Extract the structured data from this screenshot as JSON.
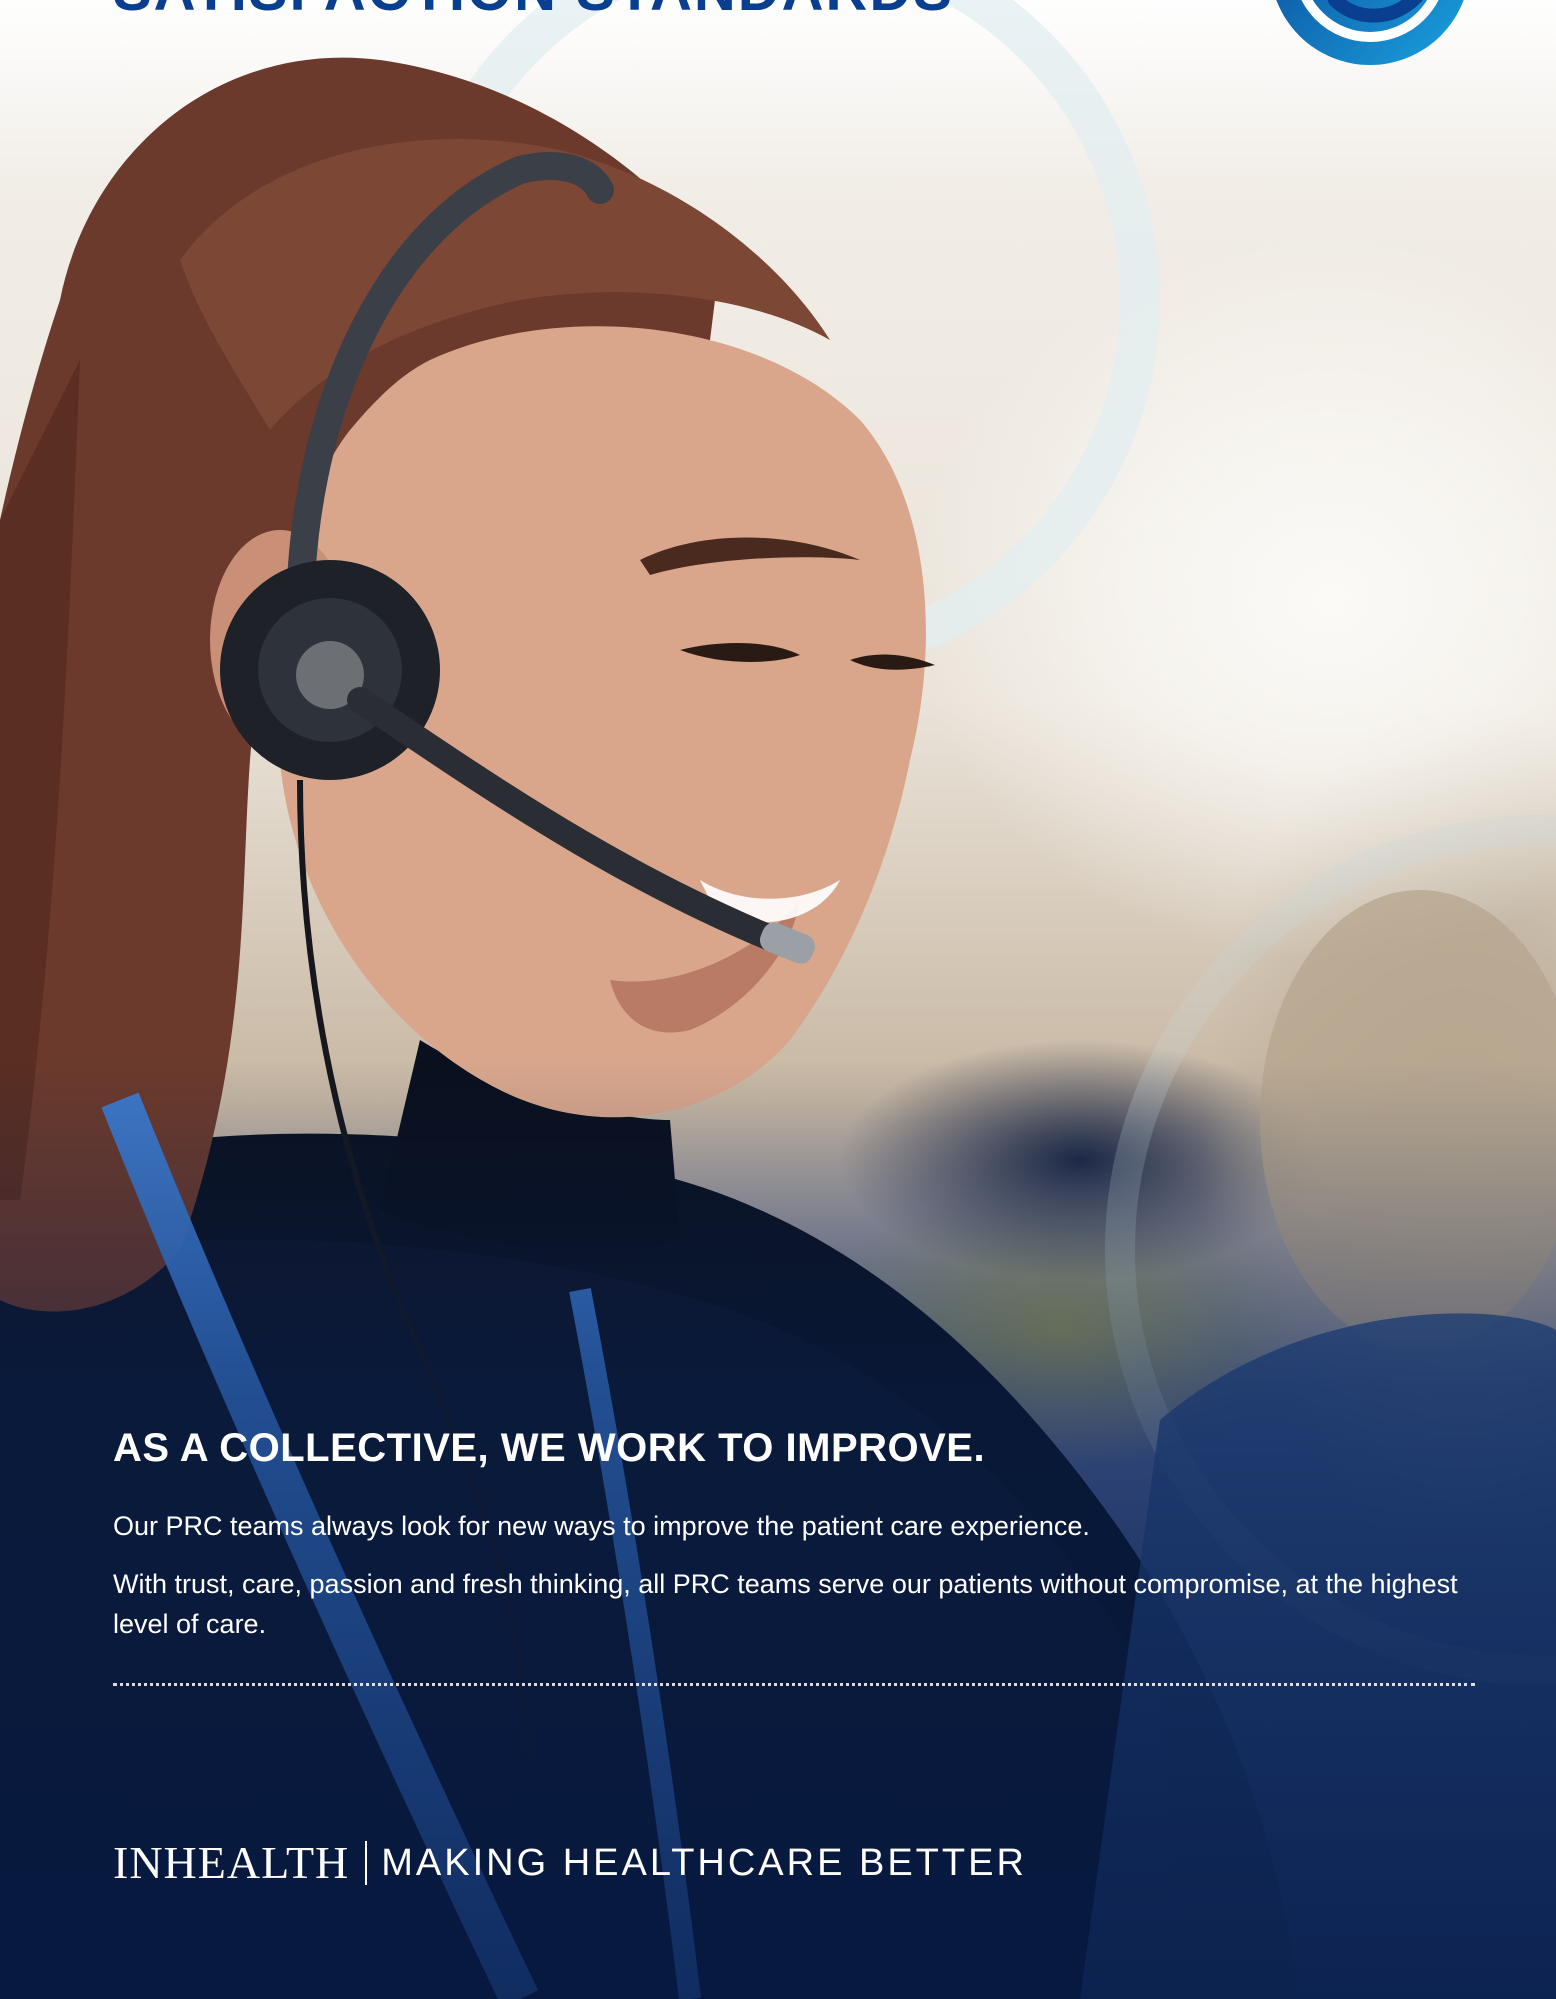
{
  "header": {
    "title": "SATISFACTION STANDARDS"
  },
  "content": {
    "heading": "AS A COLLECTIVE, WE WORK TO IMPROVE.",
    "paragraphs": [
      "Our PRC teams always look for new ways to improve the patient care experience.",
      "With trust, care, passion and fresh thinking, all PRC teams serve our patients without compromise, at the highest level of care."
    ]
  },
  "footer": {
    "brand": "INHEALTH",
    "tagline": "MAKING HEALTHCARE BETTER"
  },
  "colors": {
    "brand_blue": "#0a3f8f",
    "badge_blue": "#0b5fc2",
    "text_light": "#ffffff"
  },
  "icons": {
    "badge": "smile-badge-icon",
    "headset": "headset-icon"
  }
}
